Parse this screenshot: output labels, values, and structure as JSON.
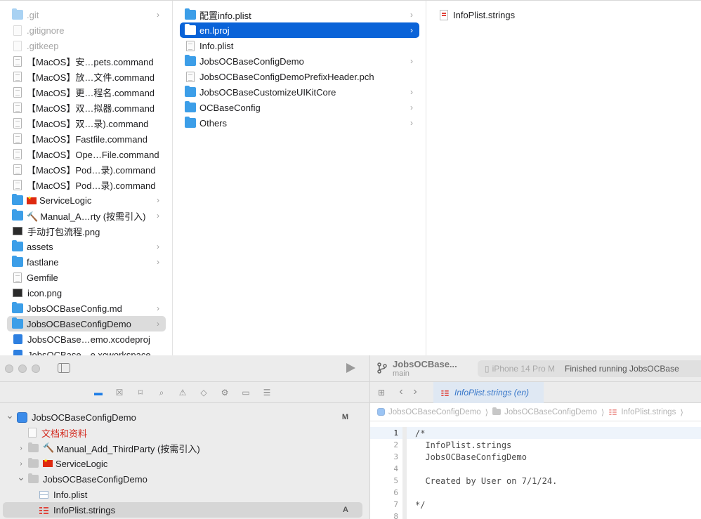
{
  "finder": {
    "column1": [
      {
        "name": ".git",
        "icon": "folder-icon",
        "chevron": true,
        "dim": true
      },
      {
        "name": ".gitignore",
        "icon": "file-icon",
        "dim": true
      },
      {
        "name": ".gitkeep",
        "icon": "file-icon",
        "dim": true
      },
      {
        "name": "【MacOS】安…pets.command",
        "icon": "script-icon"
      },
      {
        "name": "【MacOS】放…文件.command",
        "icon": "script-icon"
      },
      {
        "name": "【MacOS】更…程名.command",
        "icon": "script-icon"
      },
      {
        "name": "【MacOS】双…拟器.command",
        "icon": "script-icon"
      },
      {
        "name": "【MacOS】双…录).command",
        "icon": "script-icon"
      },
      {
        "name": "【MacOS】Fastfile.command",
        "icon": "script-icon"
      },
      {
        "name": "【MacOS】Ope…File.command",
        "icon": "script-icon"
      },
      {
        "name": "【MacOS】Pod…录).command",
        "icon": "script-icon"
      },
      {
        "name": "【MacOS】Pod…录).command",
        "icon": "script-icon"
      },
      {
        "name": "ServiceLogic",
        "icon": "folder-icon",
        "chevron": true,
        "prefix": "flag"
      },
      {
        "name": "Manual_A…rty (按需引入)",
        "icon": "folder-icon",
        "chevron": true,
        "prefix": "hammer"
      },
      {
        "name": "手动打包流程.png",
        "icon": "image-icon"
      },
      {
        "name": "assets",
        "icon": "folder-icon",
        "chevron": true
      },
      {
        "name": "fastlane",
        "icon": "folder-icon",
        "chevron": true
      },
      {
        "name": "Gemfile",
        "icon": "file-icon"
      },
      {
        "name": "icon.png",
        "icon": "image-icon"
      },
      {
        "name": "JobsOCBaseConfig.md",
        "icon": "folder-icon",
        "chevron": true
      },
      {
        "name": "JobsOCBaseConfigDemo",
        "icon": "folder-icon",
        "chevron": true,
        "selected": "gray"
      },
      {
        "name": "JobsOCBase…emo.xcodeproj",
        "icon": "xcodeproj-icon"
      },
      {
        "name": "JobsOCBase…e.xcworkspace",
        "icon": "xcworkspace-icon"
      }
    ],
    "column2": [
      {
        "name": "配置info.plist",
        "icon": "folder-icon",
        "chevron": true
      },
      {
        "name": "en.lproj",
        "icon": "folder-icon",
        "chevron": true,
        "selected": "blue"
      },
      {
        "name": "Info.plist",
        "icon": "file-icon"
      },
      {
        "name": "JobsOCBaseConfigDemo",
        "icon": "folder-icon",
        "chevron": true
      },
      {
        "name": "JobsOCBaseConfigDemoPrefixHeader.pch",
        "icon": "file-icon"
      },
      {
        "name": "JobsOCBaseCustomizeUIKitCore",
        "icon": "folder-icon",
        "chevron": true
      },
      {
        "name": "OCBaseConfig",
        "icon": "folder-icon",
        "chevron": true
      },
      {
        "name": "Others",
        "icon": "folder-icon",
        "chevron": true
      }
    ],
    "column3": [
      {
        "name": "InfoPlist.strings",
        "icon": "strings-file-icon"
      }
    ]
  },
  "xcode": {
    "navigator": {
      "tree": [
        {
          "label": "JobsOCBaseConfigDemo",
          "level": 0,
          "disclosure": "open",
          "icon": "project-icon",
          "badge": "M"
        },
        {
          "label": "文档和资料",
          "level": 1,
          "icon": "document-icon",
          "red": true
        },
        {
          "label": "Manual_Add_ThirdParty (按需引入)",
          "level": 1,
          "disclosure": "closed",
          "icon": "group-folder-icon",
          "prefix": "hammer"
        },
        {
          "label": "ServiceLogic",
          "level": 1,
          "disclosure": "closed",
          "icon": "group-folder-icon",
          "prefix": "flag"
        },
        {
          "label": "JobsOCBaseConfigDemo",
          "level": 1,
          "disclosure": "open",
          "icon": "group-folder-icon"
        },
        {
          "label": "Info.plist",
          "level": 2,
          "icon": "plist-icon"
        },
        {
          "label": "InfoPlist.strings",
          "level": 2,
          "icon": "strings-icon",
          "badge": "A",
          "selected": true
        }
      ]
    },
    "toolbar": {
      "scheme_name": "JobsOCBase...",
      "branch": "main",
      "run_destination": "iPhone 14 Pro M",
      "status_message": "Finished running JobsOCBase"
    },
    "editor": {
      "tab_label": "InfoPlist.strings (en)",
      "jump_bar": [
        "JobsOCBaseConfigDemo",
        "JobsOCBaseConfigDemo",
        "InfoPlist.strings"
      ],
      "code_lines": [
        "/*",
        "  InfoPlist.strings",
        "  JobsOCBaseConfigDemo",
        "",
        "  Created by User on 7/1/24.",
        "",
        "*/",
        ""
      ],
      "current_line": 1
    }
  }
}
